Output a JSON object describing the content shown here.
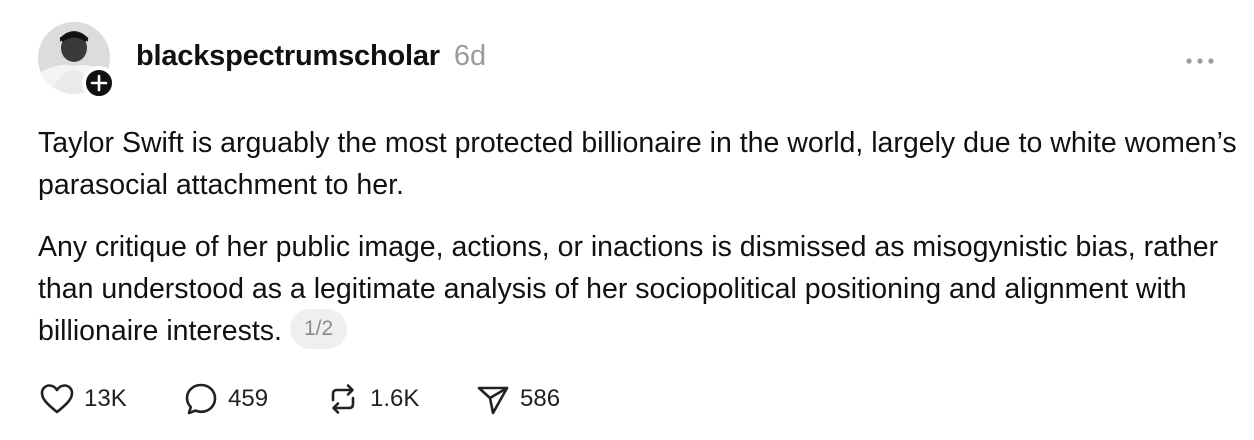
{
  "post": {
    "username": "blackspectrumscholar",
    "time": "6d",
    "paragraphs": [
      "Taylor Swift is arguably the most protected billionaire in the world, largely due to white women’s parasocial attachment to her.",
      "Any critique of her public image, actions, or inactions is dismissed as misogynistic bias, rather than understood as a legitimate analysis of her sociopolitical positioning and alignment with billionaire interests."
    ],
    "page_indicator": "1/2"
  },
  "actions": {
    "like_count": "13K",
    "reply_count": "459",
    "repost_count": "1.6K",
    "share_count": "586"
  },
  "icons": {
    "avatar": "avatar-photo",
    "follow": "plus-icon",
    "more": "more-dots-icon",
    "like": "heart-icon",
    "reply": "comment-bubble-icon",
    "repost": "repost-icon",
    "share": "send-icon"
  }
}
